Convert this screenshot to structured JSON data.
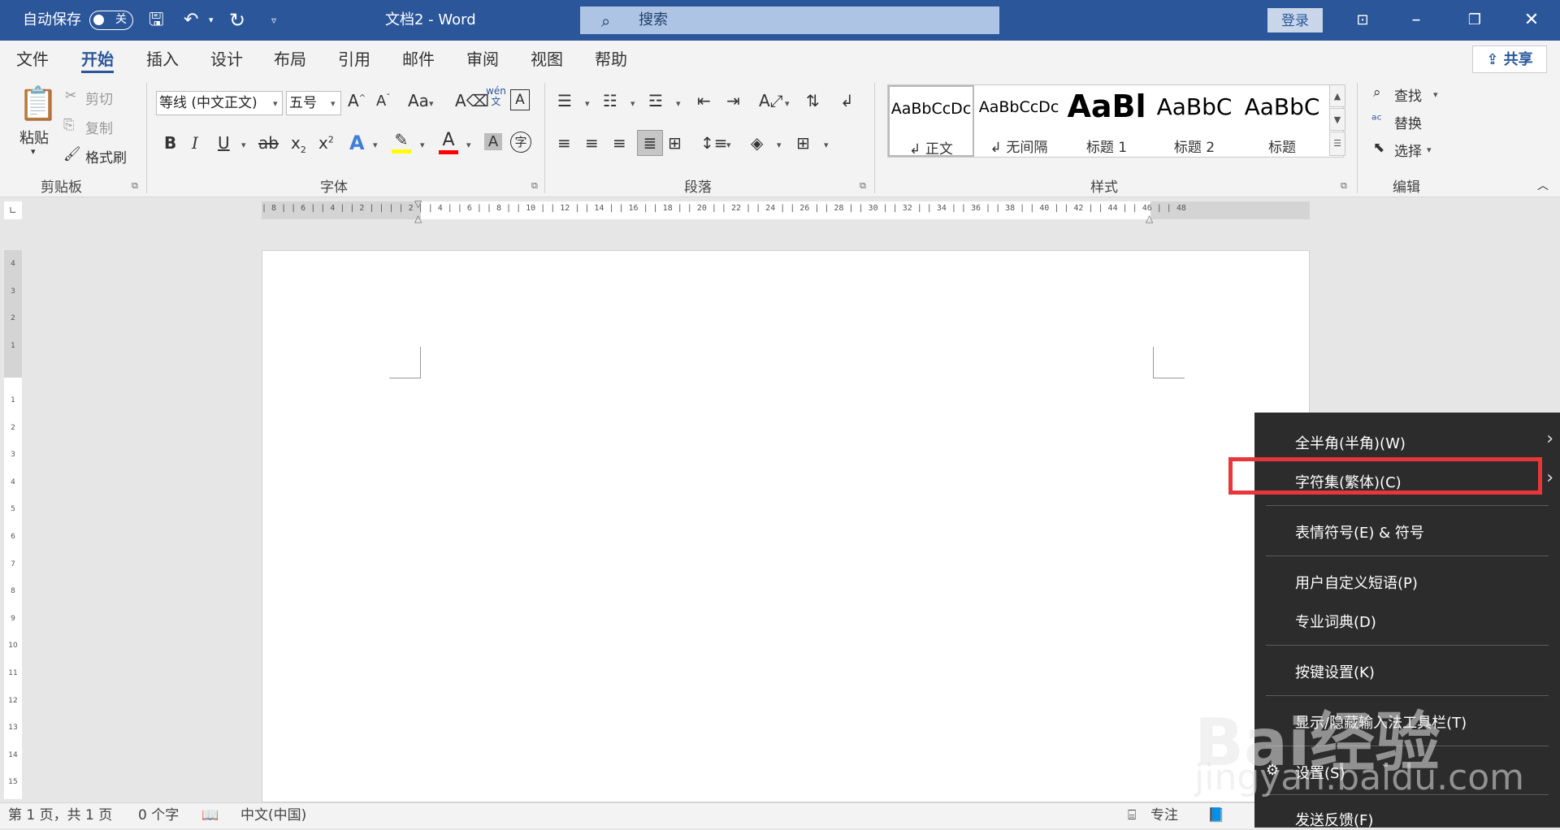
{
  "titlebar": {
    "autosave_label": "自动保存",
    "autosave_state": "关",
    "doc_title": "文档2  -  Word",
    "search_placeholder": "搜索",
    "login_label": "登录",
    "icons": [
      "save-icon",
      "undo-icon",
      "redo-icon",
      "customize-icon",
      "ribbon-display-icon",
      "minimize-icon",
      "restore-icon",
      "close-icon"
    ]
  },
  "tabs": [
    "文件",
    "开始",
    "插入",
    "设计",
    "布局",
    "引用",
    "邮件",
    "审阅",
    "视图",
    "帮助"
  ],
  "active_tab": "开始",
  "share_label": "共享",
  "clipboard": {
    "group": "剪贴板",
    "paste": "粘贴",
    "cut": "剪切",
    "copy": "复制",
    "format_painter": "格式刷"
  },
  "font": {
    "group": "字体",
    "font_name": "等线 (中文正文)",
    "font_size": "五号",
    "change_case": "Aa",
    "phonetic_top": "wén",
    "phonetic_bottom": "文",
    "border_char": "A",
    "shading_char": "A",
    "enclose_char": "字",
    "bold": "B",
    "italic": "I",
    "underline": "U",
    "strike": "ab",
    "subscript": "x",
    "sub_mark": "2",
    "superscript": "x",
    "sup_mark": "2",
    "text_effect": "A",
    "font_color": "A",
    "grow": "A",
    "shrink": "A"
  },
  "paragraph": {
    "group": "段落"
  },
  "styles": {
    "group": "样式",
    "items": [
      {
        "preview": "AaBbCcDc",
        "name": "↲ 正文"
      },
      {
        "preview": "AaBbCcDc",
        "name": "↲ 无间隔"
      },
      {
        "preview": "AaBl",
        "name": "标题 1"
      },
      {
        "preview": "AaBbC",
        "name": "标题 2"
      },
      {
        "preview": "AaBbC",
        "name": "标题"
      }
    ]
  },
  "editing": {
    "group": "编辑",
    "find": "查找",
    "replace": "替换",
    "select": "选择"
  },
  "ruler_numbers": "| 8 |  | 6 |  | 4 |  | 2 |  |   |  | 2 |  | 4 |  | 6 |  | 8 |  | 10 |  | 12 |  | 14 |  | 16 |  | 18 |  | 20 |  | 22 |  | 24 |  | 26 |  | 28 |  | 30 |  | 32 |  | 34 |  | 36 |  | 38 |  | 40 |  | 42 |  | 44 |  | 46 |  | 48",
  "vruler_numbers": [
    "4",
    "3",
    "2",
    "1",
    "",
    "1",
    "2",
    "3",
    "4",
    "5",
    "6",
    "7",
    "8",
    "9",
    "10",
    "11",
    "12",
    "13",
    "14",
    "15"
  ],
  "statusbar": {
    "page": "第 1 页，共 1 页",
    "words": "0 个字",
    "language": "中文(中国)",
    "focus": "专注"
  },
  "context_menu": {
    "items": [
      {
        "label": "全半角(半角)(W)",
        "submenu": true
      },
      {
        "label": "字符集(繁体)(C)",
        "submenu": true,
        "highlighted": true
      },
      {
        "label": "表情符号(E) & 符号",
        "submenu": false
      },
      {
        "label": "用户自定义短语(P)",
        "submenu": false
      },
      {
        "label": "专业词典(D)",
        "submenu": false
      },
      {
        "label": "按键设置(K)",
        "submenu": false
      },
      {
        "label": "显示/隐藏输入法工具栏(T)",
        "submenu": false
      },
      {
        "label": "设置(S)",
        "submenu": false
      },
      {
        "label": "发送反馈(F)",
        "submenu": false
      }
    ],
    "highlight_color": "#e8373a"
  },
  "watermark": {
    "logo": "Bai经验",
    "url": "jingyan.baidu.com"
  },
  "colors": {
    "brand": "#2b579a",
    "menu_bg": "#2c2c2c",
    "highlight_yellow": "#ffff00",
    "font_red": "#ff0000"
  }
}
